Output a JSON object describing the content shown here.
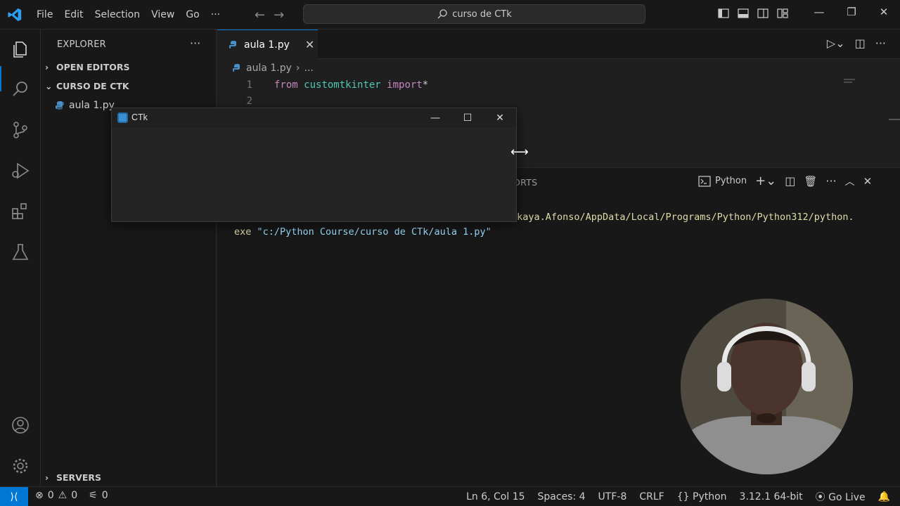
{
  "titlebar": {
    "menu": [
      "File",
      "Edit",
      "Selection",
      "View",
      "Go",
      "···"
    ],
    "search": "curso de CTk",
    "icons": [
      "back-arrow",
      "forward-arrow",
      "toggle-primary-sidebar",
      "toggle-panel",
      "toggle-secondary-sidebar",
      "customize-layout"
    ]
  },
  "sidebar": {
    "title": "EXPLORER",
    "more": "···",
    "open_editors": "OPEN EDITORS",
    "folder": "CURSO DE CTK",
    "file": "aula 1.py",
    "servers": "SERVERS"
  },
  "editor": {
    "tab_label": "aula 1.py",
    "breadcrumb_file": "aula 1.py",
    "breadcrumb_rest": "...",
    "lines": [
      {
        "num": "1",
        "kw": "from",
        "mod": "customtkinter",
        "kw2": "import",
        "rest": "*"
      },
      {
        "num": "2"
      }
    ]
  },
  "panel": {
    "ports_tab": "ORTS",
    "shell_name": "Python",
    "terminal_line1": "akaya.Afonso/AppData/Local/Programs/Python/Python312/python.",
    "terminal_line2_prefix": "exe ",
    "terminal_line2_str": "\"c:/Python Course/curso de CTk/aula 1.py\""
  },
  "ctk_window": {
    "title": "CTk",
    "minimize": "—",
    "maximize": "☐",
    "close": "✕"
  },
  "statusbar": {
    "errors": "0",
    "warnings": "0",
    "ports": "0",
    "position": "Ln 6, Col 15",
    "spaces": "Spaces: 4",
    "encoding": "UTF-8",
    "eol": "CRLF",
    "language": "Python",
    "interpreter": "3.12.1 64-bit",
    "golive": "Go Live"
  },
  "colors": {
    "accent": "#0078d4",
    "keyword": "#c586c0",
    "module": "#4ec9b0",
    "terminal_path": "#dcdcaa"
  }
}
